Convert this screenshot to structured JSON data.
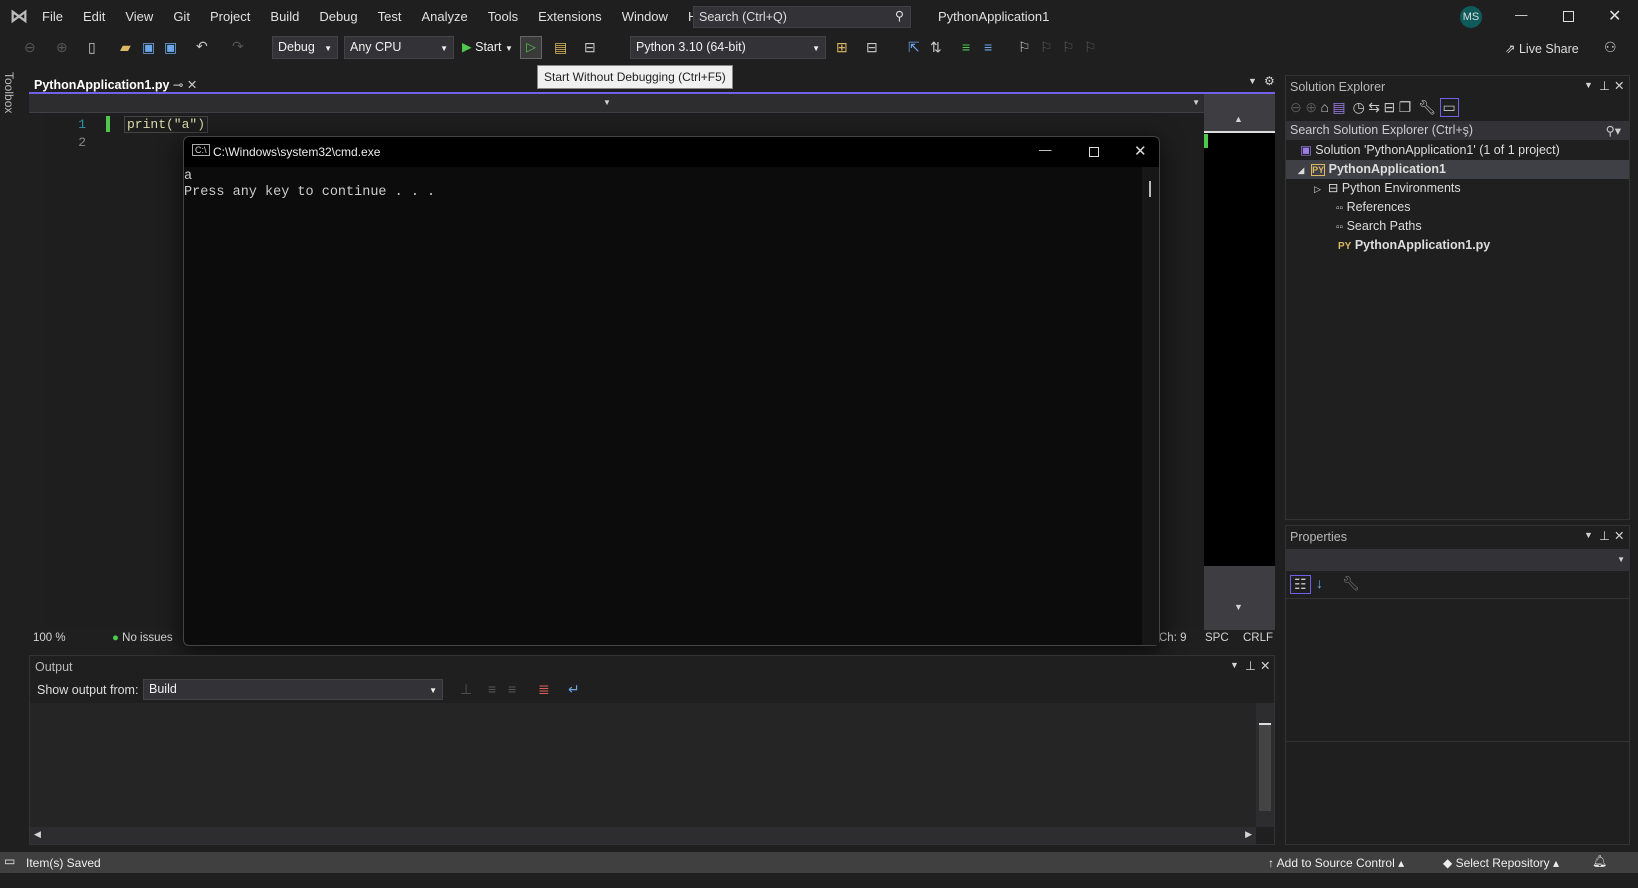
{
  "menu": [
    "File",
    "Edit",
    "View",
    "Git",
    "Project",
    "Build",
    "Debug",
    "Test",
    "Analyze",
    "Tools",
    "Extensions",
    "Window",
    "Help"
  ],
  "search_placeholder": "Search (Ctrl+Q)",
  "window_title": "PythonApplication1",
  "user_initials": "MS",
  "toolbar": {
    "config": "Debug",
    "platform": "Any CPU",
    "start": "Start",
    "interpreter": "Python 3.10 (64-bit)",
    "live_share": "Live Share"
  },
  "tooltip": "Start Without Debugging (Ctrl+F5)",
  "toolbox_label": "Toolbox",
  "tab": {
    "label": "PythonApplication1.py"
  },
  "code": {
    "lines": [
      "1",
      "2"
    ],
    "text": "print(\"a\")"
  },
  "editor_status": {
    "zoom": "100 %",
    "issues": "No issues",
    "ch": "Ch: 9",
    "spc": "SPC",
    "crlf": "CRLF"
  },
  "cmd": {
    "title": "C:\\Windows\\system32\\cmd.exe",
    "output": [
      "a",
      "Press any key to continue . . ."
    ]
  },
  "output": {
    "title": "Output",
    "show_from_label": "Show output from:",
    "source": "Build"
  },
  "solution_explorer": {
    "title": "Solution Explorer",
    "search_placeholder": "Search Solution Explorer (Ctrl+ş)",
    "items": [
      {
        "label": "Solution 'PythonApplication1' (1 of 1 project)"
      },
      {
        "label": "PythonApplication1"
      },
      {
        "label": "Python Environments"
      },
      {
        "label": "References"
      },
      {
        "label": "Search Paths"
      },
      {
        "label": "PythonApplication1.py"
      }
    ]
  },
  "properties": {
    "title": "Properties"
  },
  "statusbar": {
    "message": "Item(s) Saved",
    "source_control": "Add to Source Control",
    "repository": "Select Repository"
  },
  "colors": {
    "accent": "#7160e8",
    "python_green": "#4ec94e",
    "background": "#1f1f1f"
  }
}
